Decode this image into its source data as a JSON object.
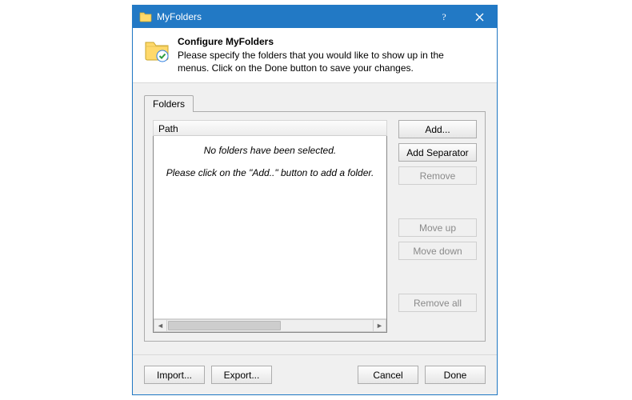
{
  "titlebar": {
    "title": "MyFolders"
  },
  "header": {
    "title": "Configure MyFolders",
    "description": "Please specify the folders that you would like to show up in the menus. Click on the Done button to save your changes."
  },
  "tabs": {
    "folders_label": "Folders"
  },
  "list": {
    "column_header": "Path",
    "placeholder_line1": "No folders have been selected.",
    "placeholder_line2": "Please click on the \"Add..\" button to add a folder."
  },
  "buttons": {
    "add": "Add...",
    "add_separator": "Add Separator",
    "remove": "Remove",
    "move_up": "Move up",
    "move_down": "Move down",
    "remove_all": "Remove all",
    "import": "Import...",
    "export": "Export...",
    "cancel": "Cancel",
    "done": "Done"
  },
  "state": {
    "remove_enabled": false,
    "move_up_enabled": false,
    "move_down_enabled": false,
    "remove_all_enabled": false
  }
}
